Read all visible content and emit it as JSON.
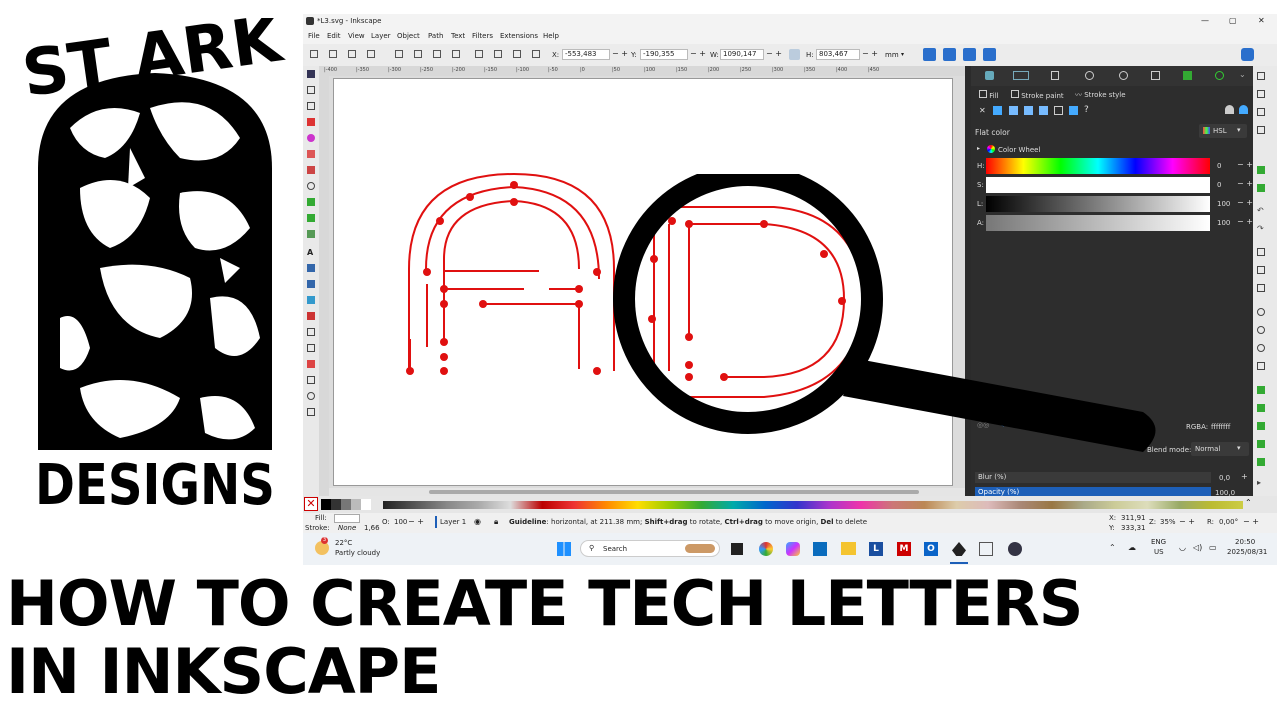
{
  "logo": {
    "top_text": "ST ARK",
    "bottom_text": "DESIGNS"
  },
  "window": {
    "title": "*L3.svg - Inkscape",
    "controls": [
      "—",
      "▢",
      "✕"
    ],
    "menu": [
      "File",
      "Edit",
      "View",
      "Layer",
      "Object",
      "Path",
      "Text",
      "Filters",
      "Extensions",
      "Help"
    ]
  },
  "toolbar": {
    "x_label": "X:",
    "x_value": "-553,483",
    "y_label": "Y:",
    "y_value": "-190,355",
    "w_label": "W:",
    "w_value": "1090,147",
    "h_label": "H:",
    "h_value": "803,467",
    "unit": "mm"
  },
  "ruler_ticks": [
    "|-400",
    "|-350",
    "|-300",
    "|-250",
    "|-200",
    "|-150",
    "|-100",
    "|-50",
    "|0",
    "|50",
    "|100",
    "|150",
    "|200",
    "|250",
    "|300",
    "|350",
    "|400",
    "|450"
  ],
  "panel": {
    "tabs": [
      "Fill",
      "Stroke paint",
      "Stroke style"
    ],
    "flat_color": "Flat color",
    "mode": "HSL",
    "color_wheel": "Color Wheel",
    "sliders": [
      {
        "label": "H:",
        "value": "0"
      },
      {
        "label": "S:",
        "value": "0"
      },
      {
        "label": "L:",
        "value": "100"
      },
      {
        "label": "A:",
        "value": "100"
      }
    ],
    "rgba_label": "RGBA:",
    "rgba_value": "ffffffff",
    "blend_label": "Blend mode:",
    "blend_value": "Normal",
    "blur_label": "Blur (%)",
    "blur_value": "0,0",
    "opacity_label": "Opacity (%)",
    "opacity_value": "100,0"
  },
  "status": {
    "fill_label": "Fill:",
    "stroke_label": "Stroke:",
    "stroke_value": "None",
    "stroke_width": "1,66",
    "opacity_label": "O:",
    "opacity_value": "100",
    "layer": "Layer 1",
    "message_bold1": "Guideline",
    "message1": ": horizontal, at 211.38 mm; ",
    "message_bold2": "Shift+drag",
    "message2": " to rotate, ",
    "message_bold3": "Ctrl+drag",
    "message3": " to move origin, ",
    "message_bold4": "Del",
    "message4": " to delete",
    "x_label": "X:",
    "x_value": "311,91",
    "y_label": "Y:",
    "y_value": "333,31",
    "z_label": "Z:",
    "z_value": "35%",
    "r_label": "R:",
    "r_value": "0,00°"
  },
  "taskbar": {
    "temp": "22°C",
    "weather": "Partly cloudy",
    "search": "Search",
    "lang1": "ENG",
    "lang2": "US",
    "time": "20:50",
    "date": "2025/08/31"
  },
  "headline": {
    "line1": "HOW TO CREATE TECH LETTERS",
    "line2": "IN INKSCAPE"
  },
  "colors": {
    "accent": "#1d5fb8",
    "stroke_red": "#e01010",
    "panel_bg": "#2d2d2d"
  }
}
